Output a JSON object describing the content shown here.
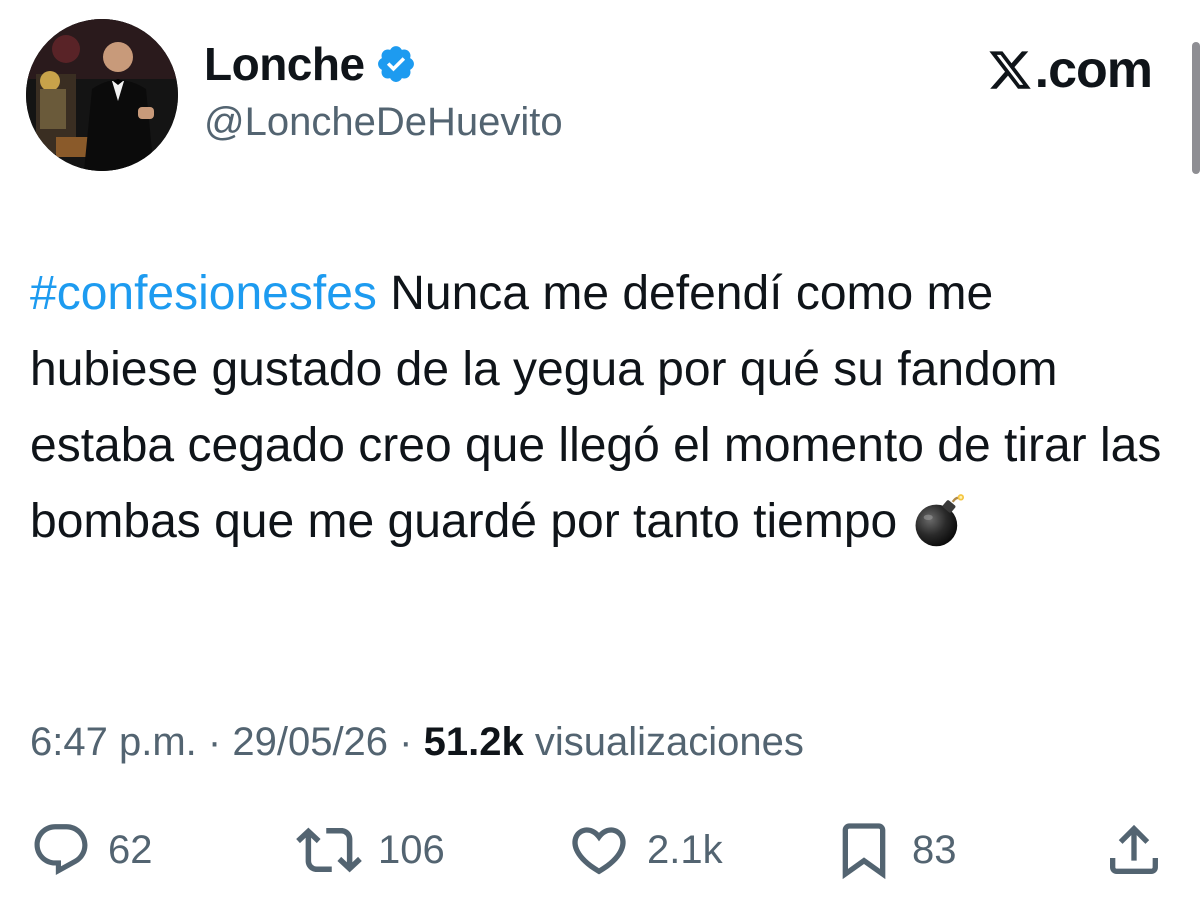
{
  "author": {
    "display_name": "Lonche",
    "handle": "@LoncheDeHuevito",
    "verified": true,
    "avatar": "profile-photo"
  },
  "brand": {
    "text": ".com",
    "logo": "x-logo-icon"
  },
  "tweet": {
    "hashtag": "#confesionesfes",
    "text": " Nunca me defendí como me hubiese gustado de la yegua por qué su fandom estaba cegado creo que llegó el momento de tirar las bombas que me guardé por tanto tiempo ",
    "emoji": "bomb-icon"
  },
  "meta": {
    "time": "6:47 p.m.",
    "separator": "·",
    "date": "29/05/26",
    "views_count": "51.2k",
    "views_label": "visualizaciones"
  },
  "actions": {
    "replies": "62",
    "reposts": "106",
    "likes": "2.1k",
    "bookmarks": "83"
  },
  "colors": {
    "text": "#0f1419",
    "secondary": "#536471",
    "accent": "#1d9bf0"
  }
}
